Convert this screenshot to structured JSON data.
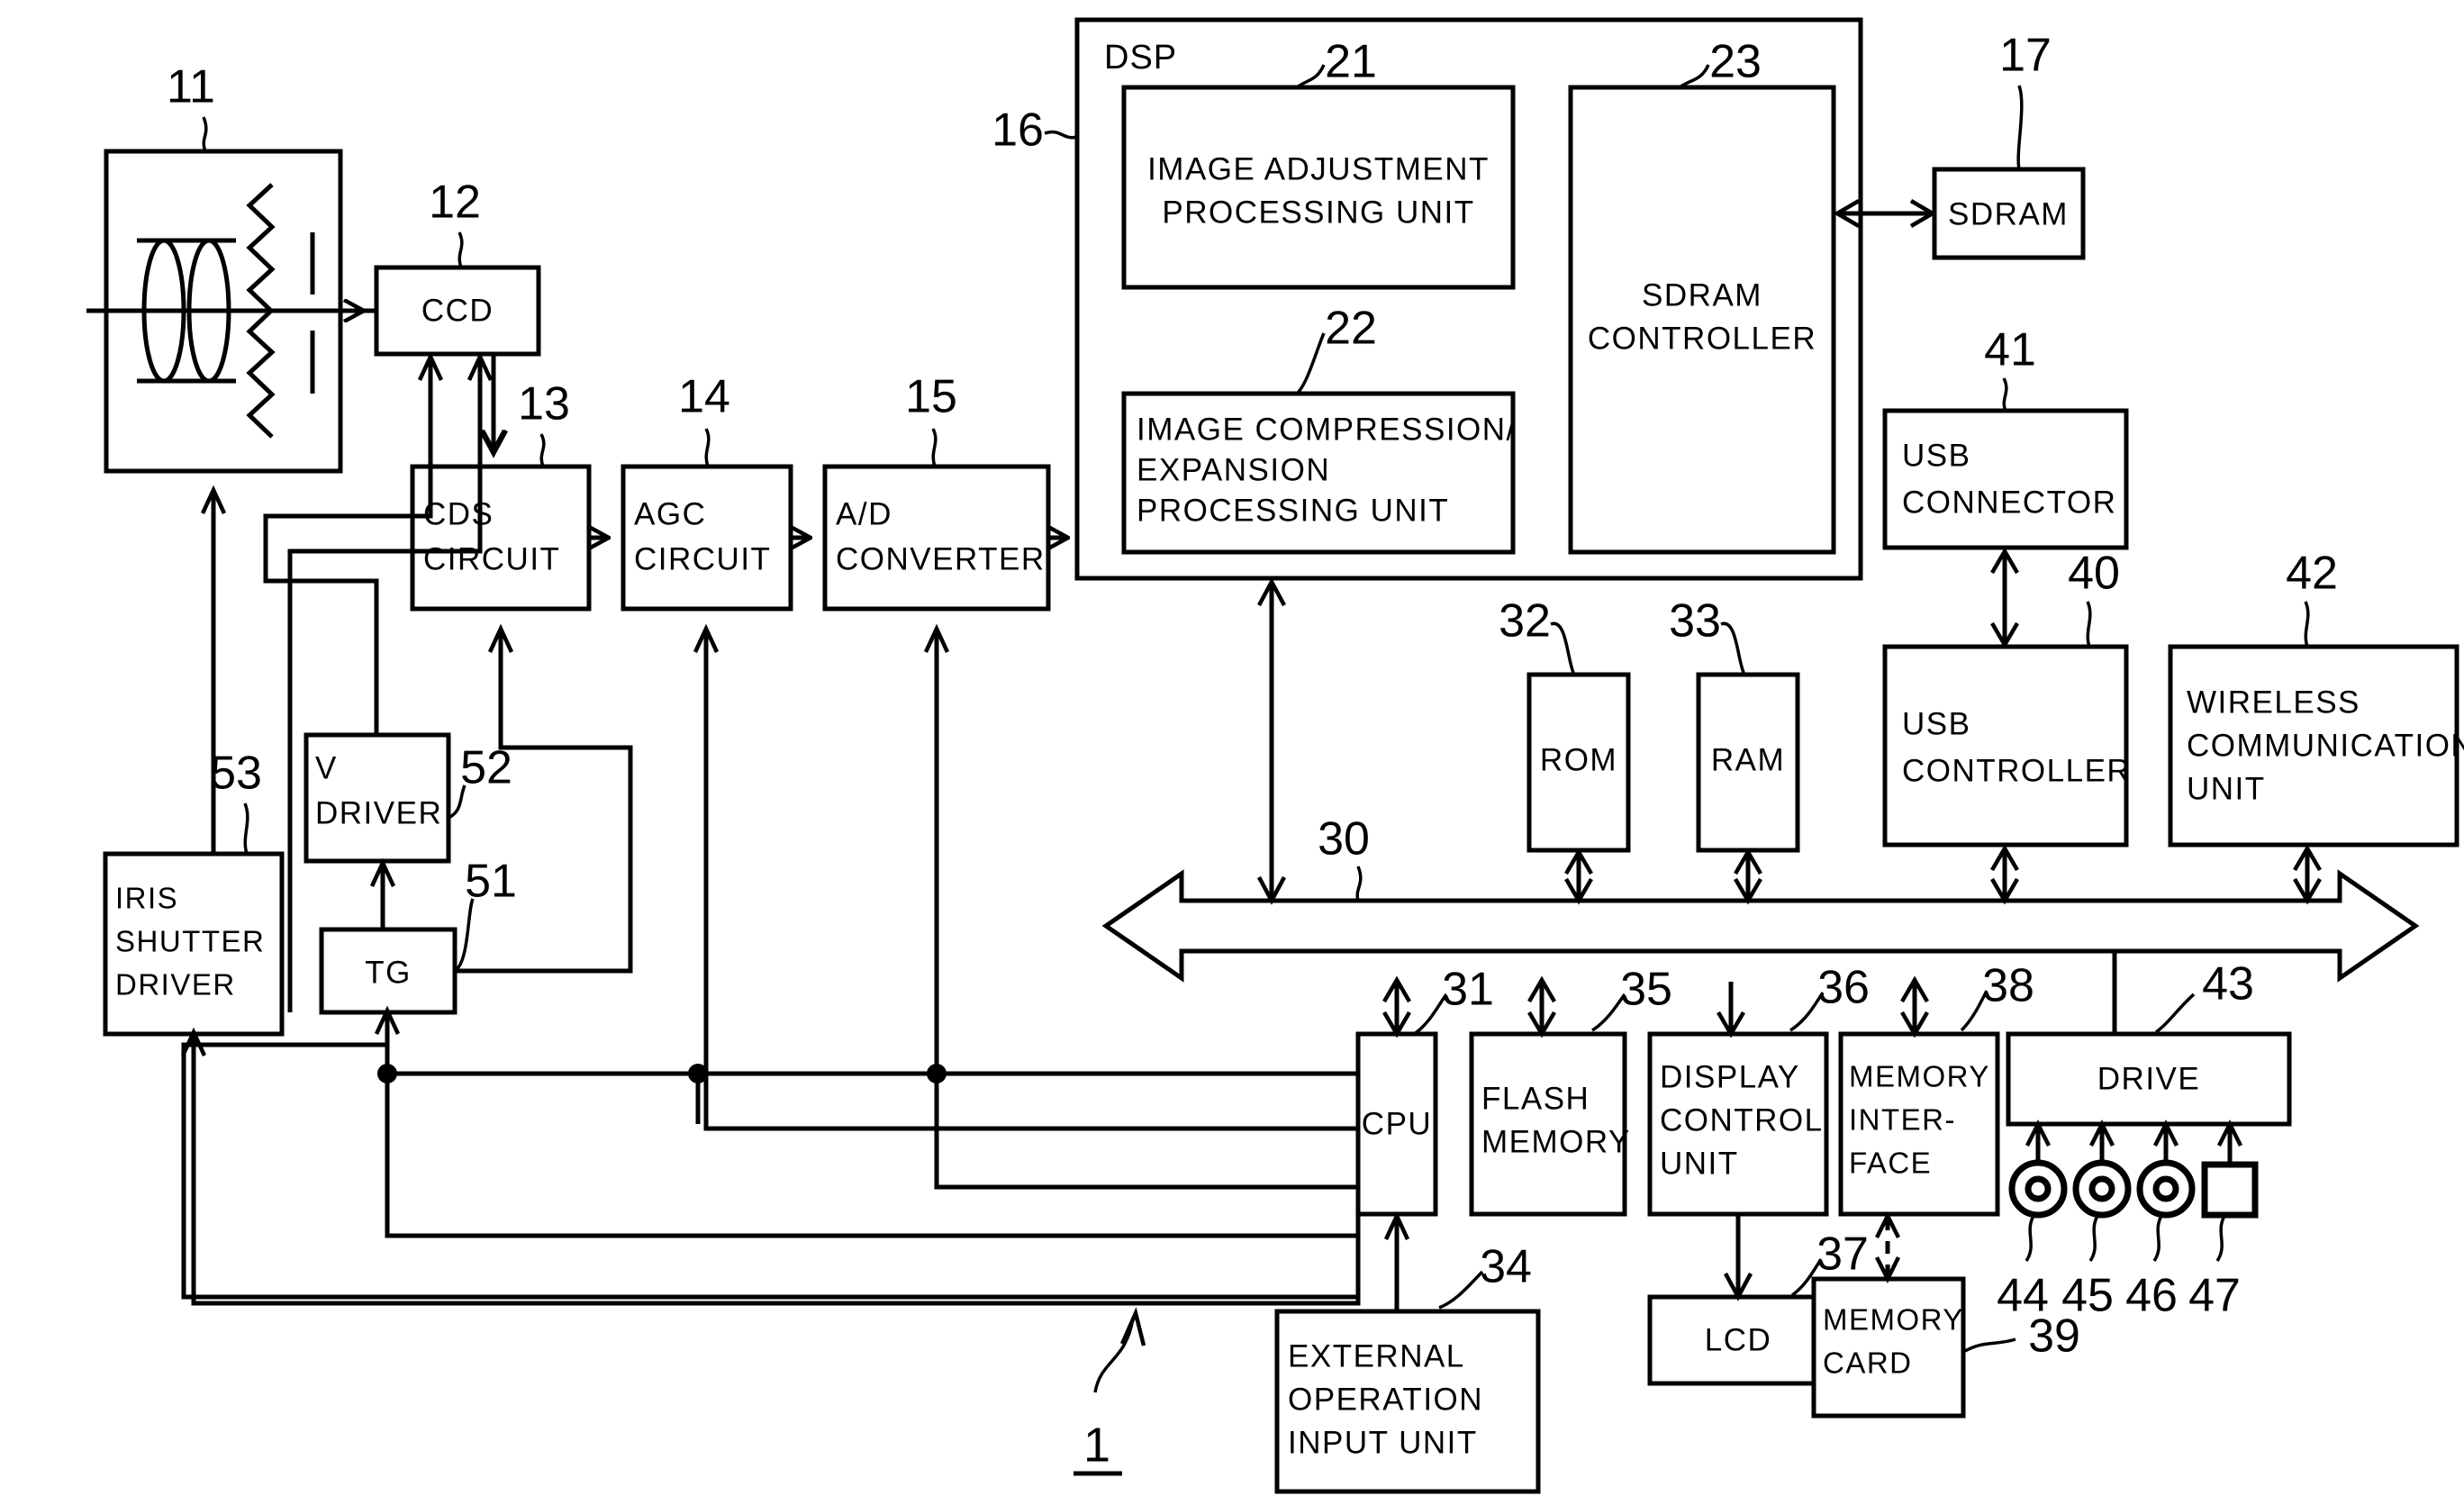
{
  "figure": {
    "system_ref": "1",
    "container_refs": {
      "dsp": "16"
    }
  },
  "blocks": [
    {
      "id": "lens",
      "ref": "11",
      "lines": []
    },
    {
      "id": "ccd",
      "ref": "12",
      "lines": [
        "CCD"
      ]
    },
    {
      "id": "cds",
      "ref": "13",
      "lines": [
        "CDS",
        "CIRCUIT"
      ]
    },
    {
      "id": "agc",
      "ref": "14",
      "lines": [
        "AGC",
        "CIRCUIT"
      ]
    },
    {
      "id": "adc",
      "ref": "15",
      "lines": [
        "A/D",
        "CONVERTER"
      ]
    },
    {
      "id": "dsp",
      "ref": "16",
      "lines": [
        "DSP"
      ]
    },
    {
      "id": "sdram",
      "ref": "17",
      "lines": [
        "SDRAM"
      ]
    },
    {
      "id": "imgadj",
      "ref": "21",
      "lines": [
        "IMAGE ADJUSTMENT",
        "PROCESSING UNIT"
      ]
    },
    {
      "id": "imgcomp",
      "ref": "22",
      "lines": [
        "IMAGE COMPRESSION/",
        "EXPANSION",
        "PROCESSING UNIT"
      ]
    },
    {
      "id": "sdramctl",
      "ref": "23",
      "lines": [
        "SDRAM",
        "CONTROLLER"
      ]
    },
    {
      "id": "bus",
      "ref": "30",
      "lines": []
    },
    {
      "id": "cpu",
      "ref": "31",
      "lines": [
        "CPU"
      ]
    },
    {
      "id": "rom",
      "ref": "32",
      "lines": [
        "ROM"
      ]
    },
    {
      "id": "ram",
      "ref": "33",
      "lines": [
        "RAM"
      ]
    },
    {
      "id": "extop",
      "ref": "34",
      "lines": [
        "EXTERNAL",
        "OPERATION",
        "INPUT UNIT"
      ]
    },
    {
      "id": "flash",
      "ref": "35",
      "lines": [
        "FLASH",
        "MEMORY"
      ]
    },
    {
      "id": "dispctl",
      "ref": "36",
      "lines": [
        "DISPLAY",
        "CONTROL",
        "UNIT"
      ]
    },
    {
      "id": "lcd",
      "ref": "37",
      "lines": [
        "LCD"
      ]
    },
    {
      "id": "memif",
      "ref": "38",
      "lines": [
        "MEMORY",
        "INTER-",
        "FACE"
      ]
    },
    {
      "id": "memcard",
      "ref": "39",
      "lines": [
        "MEMORY",
        "CARD"
      ]
    },
    {
      "id": "usbctl",
      "ref": "40",
      "lines": [
        "USB",
        "CONTROLLER"
      ]
    },
    {
      "id": "usbconn",
      "ref": "41",
      "lines": [
        "USB",
        "CONNECTOR"
      ]
    },
    {
      "id": "wireless",
      "ref": "42",
      "lines": [
        "WIRELESS",
        "COMMUNICATION",
        "UNIT"
      ]
    },
    {
      "id": "drive",
      "ref": "43",
      "lines": [
        "DRIVE"
      ]
    },
    {
      "id": "media44",
      "ref": "44",
      "lines": []
    },
    {
      "id": "media45",
      "ref": "45",
      "lines": []
    },
    {
      "id": "media46",
      "ref": "46",
      "lines": []
    },
    {
      "id": "media47",
      "ref": "47",
      "lines": []
    },
    {
      "id": "tg",
      "ref": "51",
      "lines": [
        "TG"
      ]
    },
    {
      "id": "vdriver",
      "ref": "52",
      "lines": [
        "V",
        "DRIVER"
      ]
    },
    {
      "id": "irisdrv",
      "ref": "53",
      "lines": [
        "IRIS",
        "SHUTTER",
        "DRIVER"
      ]
    }
  ],
  "text": {
    "ccd": "CCD",
    "cds_1": "CDS",
    "cds_2": "CIRCUIT",
    "agc_1": "AGC",
    "agc_2": "CIRCUIT",
    "adc_1": "A/D",
    "adc_2": "CONVERTER",
    "dsp": "DSP",
    "sdram": "SDRAM",
    "imgadj_1": "IMAGE ADJUSTMENT",
    "imgadj_2": "PROCESSING UNIT",
    "imgcomp_1": "IMAGE COMPRESSION/",
    "imgcomp_2": "EXPANSION",
    "imgcomp_3": "PROCESSING UNIT",
    "sdramctl_1": "SDRAM",
    "sdramctl_2": "CONTROLLER",
    "cpu": "CPU",
    "rom": "ROM",
    "ram": "RAM",
    "extop_1": "EXTERNAL",
    "extop_2": "OPERATION",
    "extop_3": "INPUT UNIT",
    "flash_1": "FLASH",
    "flash_2": "MEMORY",
    "dispctl_1": "DISPLAY",
    "dispctl_2": "CONTROL",
    "dispctl_3": "UNIT",
    "lcd": "LCD",
    "memif_1": "MEMORY",
    "memif_2": "INTER-",
    "memif_3": "FACE",
    "memcard_1": "MEMORY",
    "memcard_2": "CARD",
    "usbctl_1": "USB",
    "usbctl_2": "CONTROLLER",
    "usbconn_1": "USB",
    "usbconn_2": "CONNECTOR",
    "wireless_1": "WIRELESS",
    "wireless_2": "COMMUNICATION",
    "wireless_3": "UNIT",
    "drive": "DRIVE",
    "tg": "TG",
    "vdriver_1": "V",
    "vdriver_2": "DRIVER",
    "irisdrv_1": "IRIS",
    "irisdrv_2": "SHUTTER",
    "irisdrv_3": "DRIVER"
  },
  "refs": {
    "n1": "1",
    "n11": "11",
    "n12": "12",
    "n13": "13",
    "n14": "14",
    "n15": "15",
    "n16": "16",
    "n17": "17",
    "n21": "21",
    "n22": "22",
    "n23": "23",
    "n30": "30",
    "n31": "31",
    "n32": "32",
    "n33": "33",
    "n34": "34",
    "n35": "35",
    "n36": "36",
    "n37": "37",
    "n38": "38",
    "n39": "39",
    "n40": "40",
    "n41": "41",
    "n42": "42",
    "n43": "43",
    "n44": "44",
    "n45": "45",
    "n46": "46",
    "n47": "47",
    "n51": "51",
    "n52": "52",
    "n53": "53"
  },
  "colors": {
    "ink": "#000000",
    "paper": "#ffffff"
  }
}
